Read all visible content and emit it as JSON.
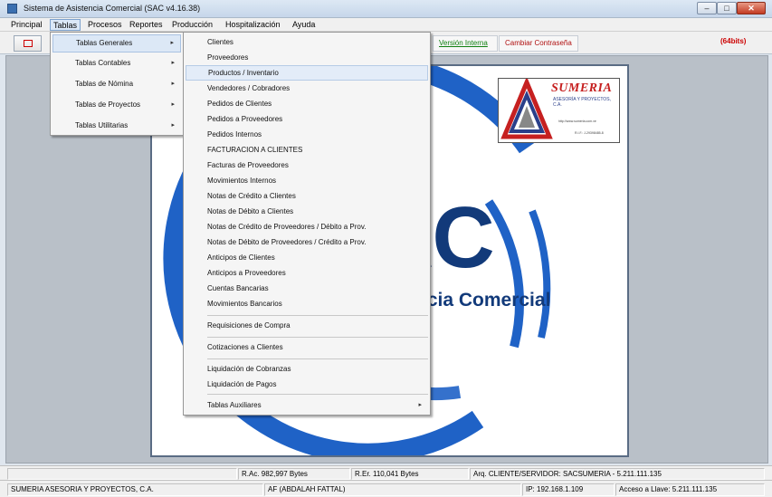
{
  "window": {
    "title": "Sistema de Asistencia Comercial  (SAC v4.16.38)",
    "buttons": {
      "minimize": "–",
      "maximize": "□",
      "close": "✕"
    }
  },
  "menubar": [
    "Principal",
    "Tablas",
    "Procesos",
    "Reportes",
    "Producción",
    "Hospitalización",
    "Ayuda"
  ],
  "toolbar": {
    "version": "Versión Interna",
    "password": "Cambiar Contraseña",
    "bits": "(64bits)"
  },
  "tablas_menu": [
    {
      "label": "Tablas Generales",
      "arrow": "▸"
    },
    {
      "label": "Tablas Contables",
      "arrow": "▸"
    },
    {
      "label": "Tablas de Nómina",
      "arrow": "▸"
    },
    {
      "label": "Tablas de Proyectos",
      "arrow": "▸"
    },
    {
      "label": "Tablas Utilitarias",
      "arrow": "▸"
    }
  ],
  "generales_menu": [
    "Clientes",
    "Proveedores",
    "Productos / Inventario",
    "Vendedores / Cobradores",
    "Pedidos de Clientes",
    "Pedidos a Proveedores",
    "Pedidos Internos",
    "FACTURACION A CLIENTES",
    "Facturas de Proveedores",
    "Movimientos Internos",
    "Notas de Crédito a Clientes",
    "Notas de Débito a Clientes",
    "Notas de Crédito de Proveedores / Débito a Prov.",
    "Notas de Débito de Proveedores / Crédito a Prov.",
    "Anticipos de Clientes",
    "Anticipos a Proveedores",
    "Cuentas Bancarias",
    "Movimientos Bancarios",
    "Requisiciones de Compra",
    "Cotizaciones a Clientes",
    "Liquidación de Cobranzas",
    "Liquidación de Pagos",
    "Tablas Auxiliares"
  ],
  "generales_arrow": "▸",
  "logo": {
    "brand": "SUMERIA",
    "subtitle": "ASESORÍA Y PROYECTOS, C.A.",
    "web": "http://www.sumeria.com.ve",
    "rif": "R.I.F.: J-29398485-8",
    "big": "AC",
    "text": "ncia Comercial"
  },
  "status1": {
    "rac": "R.Ac. 982,997 Bytes",
    "rer": "R.Er. 110,041 Bytes",
    "arq": "Arq. CLIENTE/SERVIDOR:  SACSUMERIA - 5.211.111.135"
  },
  "status2": {
    "company": "SUMERIA ASESORIA Y PROYECTOS, C.A.",
    "user": "AF (ABDALAH FATTAL)",
    "ip": "IP: 192.168.1.109",
    "key": "Acceso a Llave: 5.211.111.135"
  },
  "colors": {
    "accent_red": "#c00000",
    "logo_blue": "#123a7a",
    "link_green": "#108010"
  }
}
